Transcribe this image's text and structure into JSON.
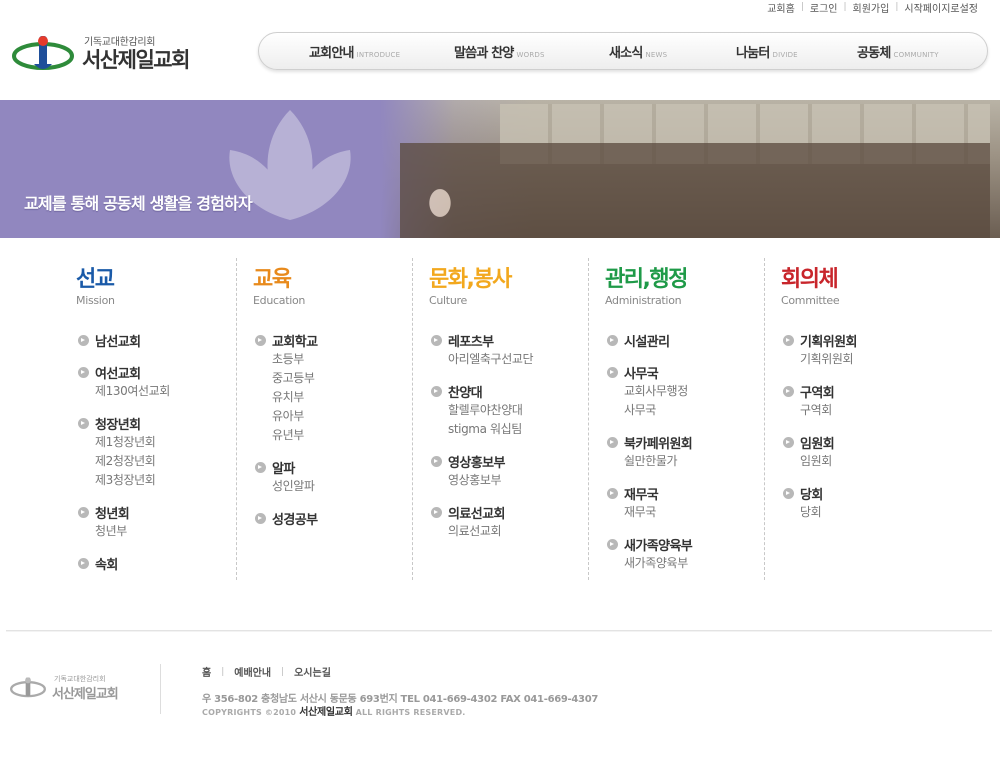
{
  "util": {
    "links": [
      "교회홈",
      "로그인",
      "회원가입",
      "시작페이지로설정"
    ]
  },
  "logo": {
    "sub": "기독교대한감리회",
    "main": "서산제일교회"
  },
  "gnb": [
    {
      "ko": "교회안내",
      "en": "INTRODUCE"
    },
    {
      "ko": "말씀과 찬양",
      "en": "WORDS"
    },
    {
      "ko": "새소식",
      "en": "NEWS"
    },
    {
      "ko": "나눔터",
      "en": "DIVIDE"
    },
    {
      "ko": "공동체",
      "en": "COMMUNITY"
    }
  ],
  "banner": {
    "text": "교제를 통해 공동체 생활을 경험하자"
  },
  "columns": [
    {
      "title": "선교",
      "sub": "Mission",
      "color": "#1a5aa8",
      "groups": [
        {
          "head": "남선교회",
          "items": []
        },
        {
          "head": "여선교회",
          "items": [
            "제130여선교회"
          ]
        },
        {
          "head": "청장년회",
          "items": [
            "제1청장년회",
            "제2청장년회",
            "제3청장년회"
          ]
        },
        {
          "head": "청년회",
          "items": [
            "청년부"
          ]
        },
        {
          "head": "속회",
          "items": []
        }
      ]
    },
    {
      "title": "교육",
      "sub": "Education",
      "color": "#e88a1c",
      "groups": [
        {
          "head": "교회학교",
          "items": [
            "초등부",
            "중고등부",
            "유치부",
            "유아부",
            "유년부"
          ]
        },
        {
          "head": "알파",
          "items": [
            "성인알파"
          ]
        },
        {
          "head": "성경공부",
          "items": []
        }
      ]
    },
    {
      "title": "문화,봉사",
      "sub": "Culture",
      "color": "#f2a81e",
      "groups": [
        {
          "head": "레포츠부",
          "items": [
            "아리엘축구선교단"
          ]
        },
        {
          "head": "찬양대",
          "items": [
            "할렐루야찬양대",
            "stigma 워십팀"
          ]
        },
        {
          "head": "영상홍보부",
          "items": [
            "영상홍보부"
          ]
        },
        {
          "head": "의료선교회",
          "items": [
            "의료선교회"
          ]
        }
      ]
    },
    {
      "title": "관리,행정",
      "sub": "Administration",
      "color": "#1f9a48",
      "groups": [
        {
          "head": "시설관리",
          "items": []
        },
        {
          "head": "사무국",
          "items": [
            "교회사무행정",
            "사무국"
          ]
        },
        {
          "head": "북카페위원회",
          "items": [
            "쉴만한물가"
          ]
        },
        {
          "head": "재무국",
          "items": [
            "재무국"
          ]
        },
        {
          "head": "새가족양육부",
          "items": [
            "새가족양육부"
          ]
        }
      ]
    },
    {
      "title": "회의체",
      "sub": "Committee",
      "color": "#c8252b",
      "groups": [
        {
          "head": "기획위원회",
          "items": [
            "기획위원회"
          ]
        },
        {
          "head": "구역회",
          "items": [
            "구역회"
          ]
        },
        {
          "head": "임원회",
          "items": [
            "임원회"
          ]
        },
        {
          "head": "당회",
          "items": [
            "당회"
          ]
        }
      ]
    }
  ],
  "footer": {
    "logo_sub": "기독교대한감리회",
    "logo_main": "서산제일교회",
    "links": [
      "홈",
      "예배안내",
      "오시는길"
    ],
    "address": "우 356-802  충청남도 서산시 동문동 693번지  TEL 041-669-4302  FAX 041-669-4307",
    "copy_prefix": "COPYRIGHTS ©2010",
    "copy_name": "서산제일교회",
    "copy_suffix": "ALL RIGHTS RESERVED."
  },
  "colors": {
    "banner_bg": "#9187bf",
    "mission": "#1a5aa8",
    "education": "#e88a1c",
    "culture": "#f2a81e",
    "administration": "#1f9a48",
    "committee": "#c8252b"
  }
}
